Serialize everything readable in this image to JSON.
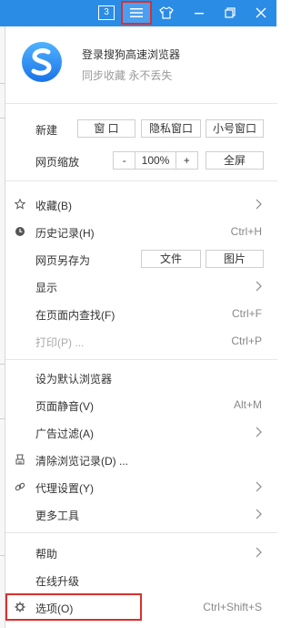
{
  "titlebar": {
    "tab_count": "3",
    "accent": "#2b8ce6",
    "icons": [
      "tab-count-icon",
      "menu-icon",
      "skin-shirt-icon",
      "minimize-icon",
      "restore-icon",
      "close-icon"
    ]
  },
  "header": {
    "title": "登录搜狗高速浏览器",
    "subtitle": "同步收藏 永不丢失"
  },
  "new_row": {
    "label": "新建",
    "buttons": [
      "窗 口",
      "隐私窗口",
      "小号窗口"
    ]
  },
  "zoom_row": {
    "label": "网页缩放",
    "minus": "-",
    "value": "100%",
    "plus": "+",
    "fullscreen": "全屏"
  },
  "menu": {
    "favorites": {
      "label": "收藏(B)"
    },
    "history": {
      "label": "历史记录(H)",
      "shortcut": "Ctrl+H"
    },
    "save_as": {
      "label": "网页另存为",
      "btn_file": "文件",
      "btn_image": "图片"
    },
    "display": {
      "label": "显示"
    },
    "find": {
      "label": "在页面内查找(F)",
      "shortcut": "Ctrl+F"
    },
    "print": {
      "label": "打印(P) ...",
      "shortcut": "Ctrl+P"
    },
    "set_default": {
      "label": "设为默认浏览器"
    },
    "mute": {
      "label": "页面静音(V)",
      "shortcut": "Alt+M"
    },
    "adblock": {
      "label": "广告过滤(A)"
    },
    "clear": {
      "label": "清除浏览记录(D) ..."
    },
    "proxy": {
      "label": "代理设置(Y)"
    },
    "more_tools": {
      "label": "更多工具"
    },
    "help": {
      "label": "帮助"
    },
    "upgrade": {
      "label": "在线升级"
    },
    "options": {
      "label": "选项(O)",
      "shortcut": "Ctrl+Shift+S"
    }
  }
}
